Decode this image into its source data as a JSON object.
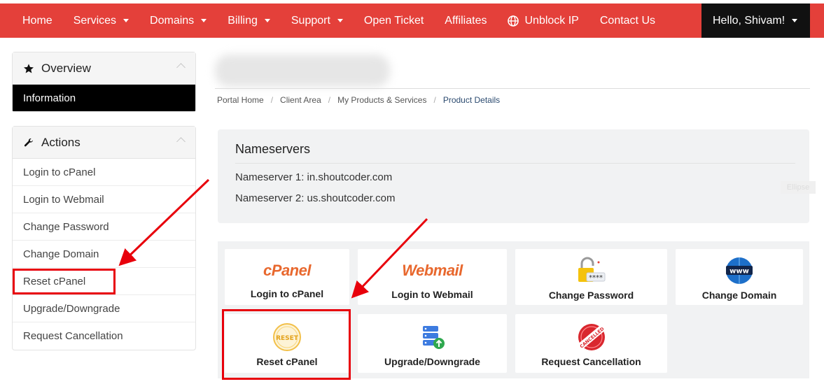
{
  "nav": {
    "items": [
      {
        "label": "Home",
        "dropdown": false
      },
      {
        "label": "Services",
        "dropdown": true
      },
      {
        "label": "Domains",
        "dropdown": true
      },
      {
        "label": "Billing",
        "dropdown": true
      },
      {
        "label": "Support",
        "dropdown": true
      },
      {
        "label": "Open Ticket",
        "dropdown": false
      },
      {
        "label": "Affiliates",
        "dropdown": false
      },
      {
        "label": "Unblock IP",
        "dropdown": false,
        "icon": "globe-icon"
      },
      {
        "label": "Contact Us",
        "dropdown": false
      }
    ],
    "user_greeting": "Hello, Shivam!"
  },
  "sidebar": {
    "overview": {
      "title": "Overview",
      "icon": "star-icon",
      "active_item": "Information"
    },
    "actions": {
      "title": "Actions",
      "icon": "wrench-icon",
      "items": [
        "Login to cPanel",
        "Login to Webmail",
        "Change Password",
        "Change Domain",
        "Reset cPanel",
        "Upgrade/Downgrade",
        "Request Cancellation"
      ]
    }
  },
  "breadcrumb": [
    "Portal Home",
    "Client Area",
    "My Products & Services",
    "Product Details"
  ],
  "nameservers": {
    "title": "Nameservers",
    "ns1": "Nameserver 1: in.shoutcoder.com",
    "ns2": "Nameserver 2: us.shoutcoder.com",
    "tag": "Ellipse"
  },
  "tiles": [
    {
      "label": "Login to cPanel",
      "logo": "cPanel",
      "icon": "cpanel-logo-icon"
    },
    {
      "label": "Login to Webmail",
      "logo": "Webmail",
      "icon": "webmail-logo-icon"
    },
    {
      "label": "Change Password",
      "icon": "padlock-icon",
      "mask": "****"
    },
    {
      "label": "Change Domain",
      "icon": "www-globe-icon",
      "badge": "www"
    },
    {
      "label": "Reset cPanel",
      "icon": "reset-icon",
      "badge": "RESET"
    },
    {
      "label": "Upgrade/Downgrade",
      "icon": "server-upgrade-icon"
    },
    {
      "label": "Request Cancellation",
      "icon": "cancelled-stamp-icon",
      "badge": "CANCELLED"
    }
  ],
  "colors": {
    "brand_red": "#e4403a",
    "annotation_red": "#e8000b",
    "dark": "#111111",
    "cpanel_orange": "#e8682e"
  }
}
